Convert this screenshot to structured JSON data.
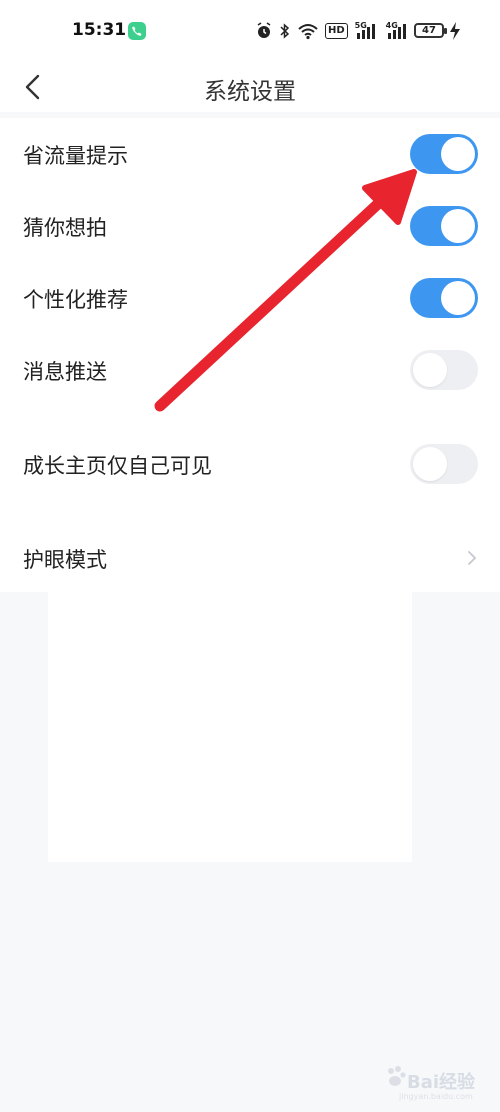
{
  "status_bar": {
    "time": "15:31",
    "network_hd": "HD",
    "sim1_type": "5G",
    "sim2_type": "4G",
    "battery_level": "47",
    "icons": [
      "phone-call-icon",
      "alarm-icon",
      "bluetooth-icon",
      "wifi-icon",
      "hd-icon",
      "signal-icon",
      "signal-icon",
      "battery-icon",
      "charging-icon"
    ]
  },
  "nav": {
    "title": "系统设置",
    "back_icon": "chevron-left-icon"
  },
  "settings": [
    {
      "id": "data-saver",
      "label": "省流量提示",
      "type": "toggle",
      "on": true
    },
    {
      "id": "guess-shoot",
      "label": "猜你想拍",
      "type": "toggle",
      "on": true
    },
    {
      "id": "personalized",
      "label": "个性化推荐",
      "type": "toggle",
      "on": true
    },
    {
      "id": "push",
      "label": "消息推送",
      "type": "toggle",
      "on": false
    },
    {
      "id": "growth-private",
      "label": "成长主页仅自己可见",
      "type": "toggle",
      "on": false
    },
    {
      "id": "eye-care",
      "label": "护眼模式",
      "type": "link"
    }
  ],
  "colors": {
    "toggle_on": "#3d97f0",
    "toggle_off": "#eeeff2",
    "annotation_arrow": "#e8242e",
    "page_bg": "#f7f8fa"
  },
  "watermark": {
    "text": "Bai经验",
    "sub": "jingyan.baidu.com"
  }
}
